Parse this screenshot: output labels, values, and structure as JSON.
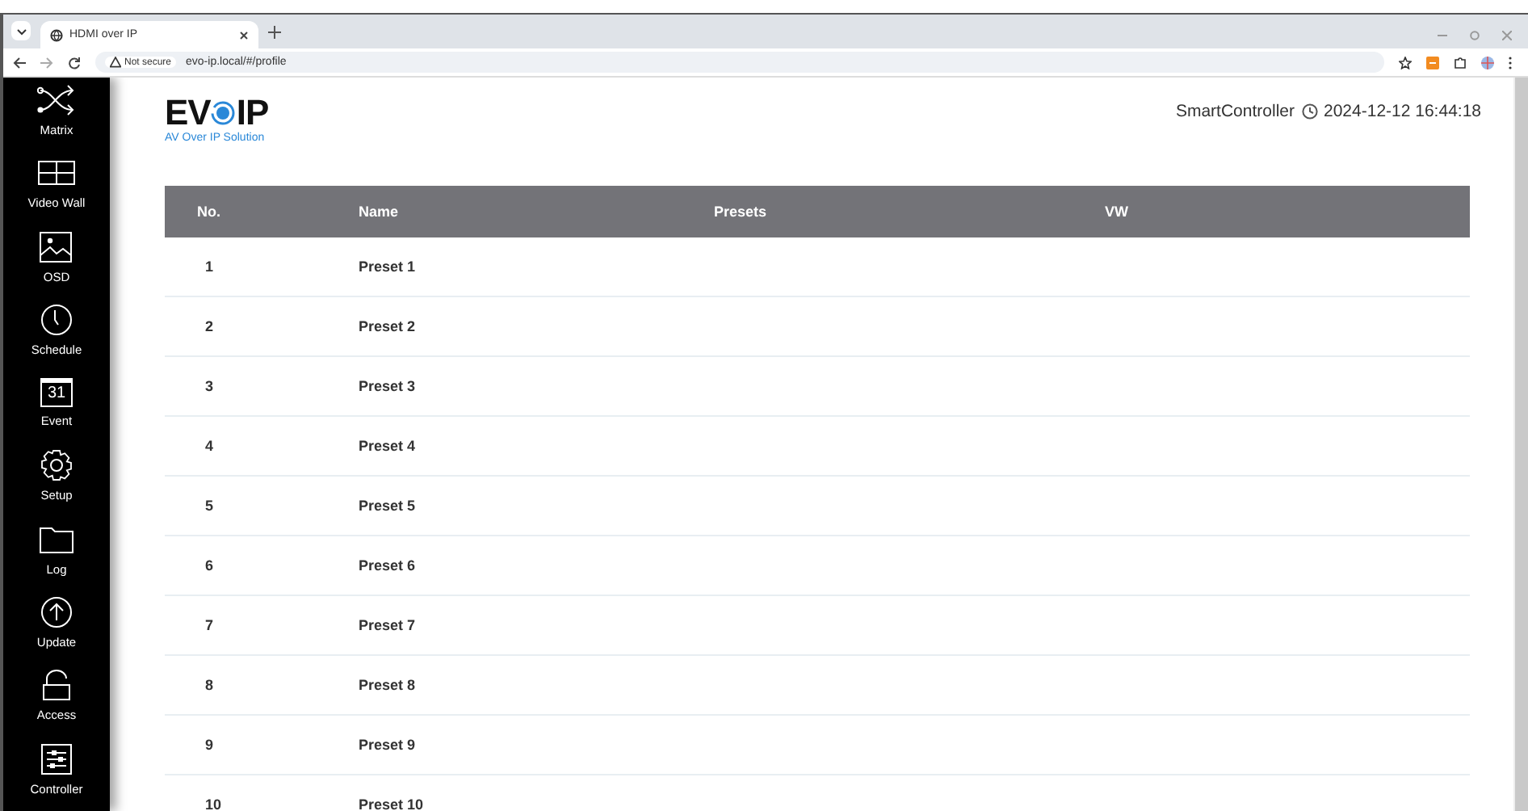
{
  "browser": {
    "tab": {
      "title": "HDMI over IP"
    },
    "address": {
      "security": "Not secure",
      "url": "evo-ip.local/#/profile"
    }
  },
  "sidebar": {
    "items": [
      {
        "label": "Matrix",
        "kind": "shuffle"
      },
      {
        "label": "Video Wall",
        "kind": "grid"
      },
      {
        "label": "OSD",
        "kind": "image"
      },
      {
        "label": "Schedule",
        "kind": "clock"
      },
      {
        "label": "Event",
        "kind": "calendar",
        "icon_text": "31"
      },
      {
        "label": "Setup",
        "kind": "gear"
      },
      {
        "label": "Log",
        "kind": "folder"
      },
      {
        "label": "Update",
        "kind": "upload"
      },
      {
        "label": "Access",
        "kind": "lock"
      },
      {
        "label": "Controller",
        "kind": "sliders"
      }
    ]
  },
  "header": {
    "logo": {
      "left": "EV",
      "right": "IP",
      "tagline": "AV Over IP Solution"
    },
    "controller": "SmartController",
    "datetime": "2024-12-12 16:44:18"
  },
  "table": {
    "columns": [
      "No.",
      "Name",
      "Presets",
      "VW"
    ],
    "rows": [
      {
        "no": "1",
        "name": "Preset 1"
      },
      {
        "no": "2",
        "name": "Preset 2"
      },
      {
        "no": "3",
        "name": "Preset 3"
      },
      {
        "no": "4",
        "name": "Preset 4"
      },
      {
        "no": "5",
        "name": "Preset 5"
      },
      {
        "no": "6",
        "name": "Preset 6"
      },
      {
        "no": "7",
        "name": "Preset 7"
      },
      {
        "no": "8",
        "name": "Preset 8"
      },
      {
        "no": "9",
        "name": "Preset 9"
      },
      {
        "no": "10",
        "name": "Preset 10"
      }
    ]
  }
}
